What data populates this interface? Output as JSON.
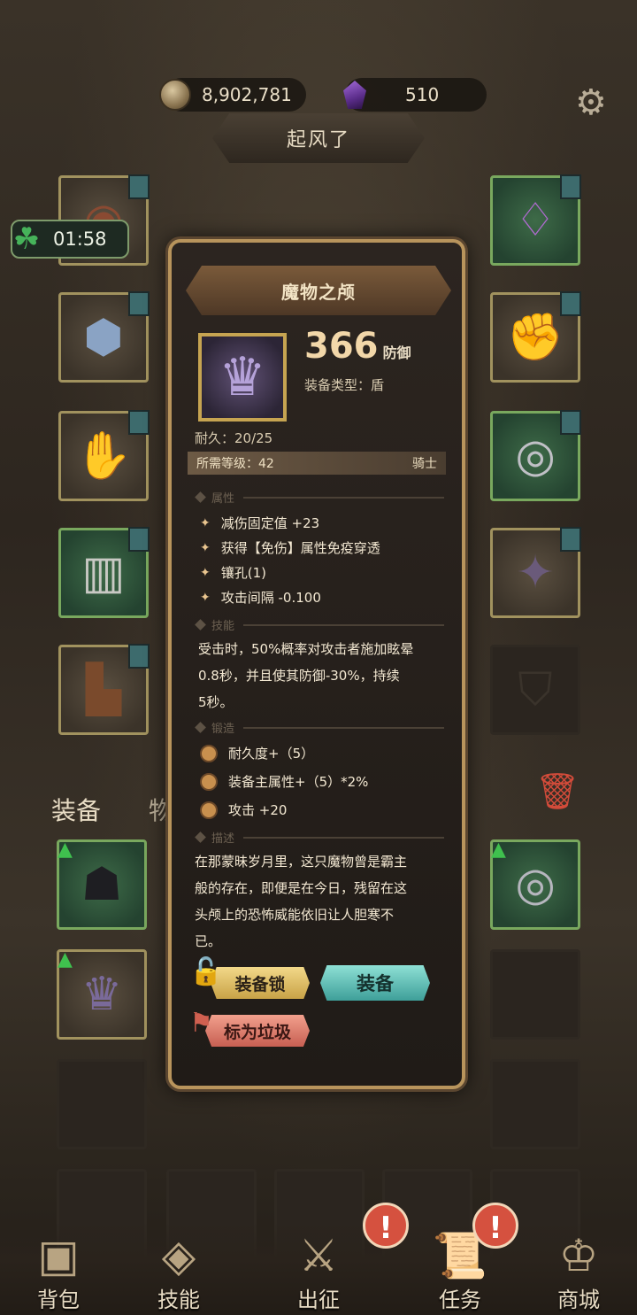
{
  "currency": {
    "coins": "8,902,781",
    "gems": "510"
  },
  "stage": {
    "title": "起风了"
  },
  "timer": {
    "value": "01:58"
  },
  "tabs": {
    "equipment": "装备",
    "items": "物品"
  },
  "item": {
    "name": "魔物之颅",
    "defense_value": "366",
    "defense_unit": "防御",
    "type_label": "装备类型：盾",
    "durability": "耐久：20/25",
    "required_level": "所需等级：42",
    "class": "骑士",
    "sections": {
      "attributes": "属性",
      "skill": "技能",
      "forge": "锻造",
      "description": "描述"
    },
    "attributes": [
      "减伤固定值 +23",
      "获得【免伤】属性免疫穿透",
      "镶孔(1)",
      "攻击间隔 -0.100"
    ],
    "skill_lines": [
      "受击时，50%概率对攻击者施加眩晕",
      "0.8秒，并且使其防御-30%，持续",
      "5秒。"
    ],
    "forge": [
      "耐久度+（5）",
      "装备主属性+（5）*2%",
      "攻击 +20"
    ],
    "description_lines": [
      "在那蒙昧岁月里，这只魔物曾是霸主",
      "般的存在，即便是在今日，残留在这",
      "头颅上的恐怖威能依旧让人胆寒不",
      "已。"
    ],
    "buttons": {
      "lock": "装备锁",
      "equip": "装备",
      "junk": "标为垃圾"
    }
  },
  "nav": {
    "items": [
      {
        "label": "背包",
        "icon": "backpack-icon"
      },
      {
        "label": "技能",
        "icon": "skill-book-icon"
      },
      {
        "label": "出征",
        "icon": "sword-map-icon"
      },
      {
        "label": "任务",
        "icon": "scroll-icon"
      },
      {
        "label": "商城",
        "icon": "crown-shop-icon"
      }
    ]
  },
  "alerts": {
    "symbol": "!"
  }
}
